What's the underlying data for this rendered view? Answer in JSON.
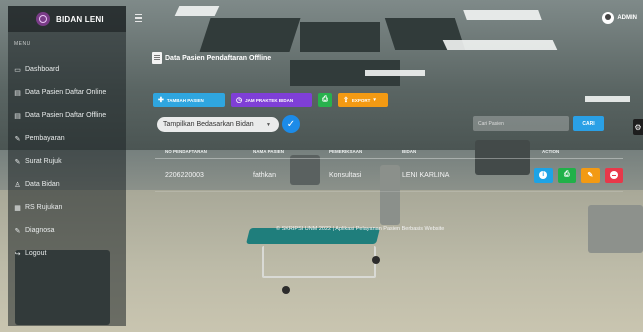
{
  "brand": {
    "name": "BIDAN LENI"
  },
  "sidebar": {
    "menu_label": "MENU",
    "items": [
      {
        "label": "Dashboard",
        "icon": "dashboard-icon",
        "glyph": "▭"
      },
      {
        "label": "Data Pasien Daftar Online",
        "icon": "file-icon",
        "glyph": "▤"
      },
      {
        "label": "Data Pasien Daftar Offline",
        "icon": "file-icon",
        "glyph": "▤"
      },
      {
        "label": "Pembayaran",
        "icon": "money-icon",
        "glyph": "✎"
      },
      {
        "label": "Surat Rujuk",
        "icon": "edit-icon",
        "glyph": "✎"
      },
      {
        "label": "Data Bidan",
        "icon": "user-icon",
        "glyph": "♙"
      },
      {
        "label": "RS Rujukan",
        "icon": "hospital-icon",
        "glyph": "▦"
      },
      {
        "label": "Diagnosa",
        "icon": "edit-icon",
        "glyph": "✎"
      },
      {
        "label": "Logout",
        "icon": "logout-icon",
        "glyph": "↪"
      }
    ]
  },
  "header": {
    "user": "ADMIN"
  },
  "page": {
    "title": "Data Pasien Pendaftaran Offline"
  },
  "toolbar": {
    "add_label": "TAMBAH PASIEN",
    "schedule_label": "JAM PRAKTEK BIDAN",
    "export_label": "EXPORT"
  },
  "filter": {
    "label": "Tampilkan Bedasarkan Bidan"
  },
  "search": {
    "placeholder": "Cari Pasien",
    "button_label": "CARI"
  },
  "table": {
    "columns": [
      "NO PENDAFTARAN",
      "NAMA PASIEN",
      "PEMERIKSAAN",
      "BIDAN",
      "ACTION"
    ],
    "rows": [
      {
        "no": "2206220003",
        "nama": "fathkan",
        "pemeriksaan": "Konsultasi",
        "bidan": "LENI KARLINA"
      }
    ]
  },
  "footer": {
    "text": "© SKRIPSI UNM 2022 | Aplikasi Pelayanan Pasien Berbasis Website"
  }
}
